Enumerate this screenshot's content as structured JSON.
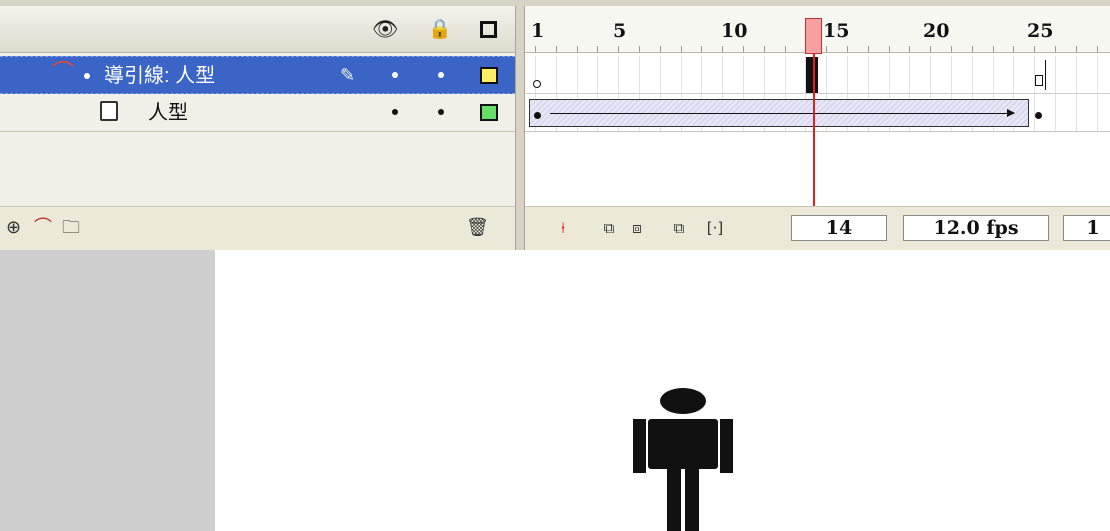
{
  "timeline": {
    "header_icons": [
      "eye-icon",
      "lock-icon",
      "outline-icon"
    ],
    "layers": [
      {
        "name": "導引線: 人型",
        "type": "motion-guide",
        "selected": true,
        "outline_color": "#ffee66"
      },
      {
        "name": "人型",
        "type": "normal",
        "selected": false,
        "outline_color": "#66dd66"
      }
    ],
    "footer_icons": [
      "insert-layer-icon",
      "add-motion-guide-icon",
      "insert-layer-folder-icon",
      "trash-icon"
    ],
    "ruler_labels": [
      "1",
      "5",
      "10",
      "15",
      "20",
      "25"
    ],
    "current_frame": "14",
    "frame_rate": "12.0 fps",
    "elapsed": "1",
    "frame_tools": [
      "center-frame-icon",
      "onion-skin-icon",
      "onion-skin-outlines-icon",
      "edit-multiple-frames-icon",
      "modify-onion-markers-icon"
    ]
  },
  "stage": {
    "pasteboard_color": "#cfcfcf",
    "figure": "human-figure"
  },
  "colors": {
    "selected_layer": "#3a64c6",
    "playhead": "#e02020"
  }
}
